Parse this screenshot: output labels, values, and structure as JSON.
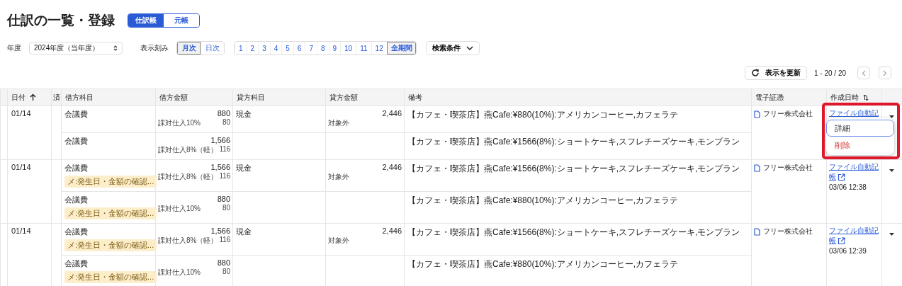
{
  "title": "仕訳の一覧・登録",
  "view_tabs": [
    {
      "label": "仕訳帳",
      "selected": true
    },
    {
      "label": "元帳",
      "selected": false
    }
  ],
  "fiscal_year": {
    "label": "年度",
    "value": "2024年度（当年度）"
  },
  "granularity": {
    "label": "表示刻み",
    "options": [
      {
        "label": "月次",
        "selected": true
      },
      {
        "label": "日次",
        "selected": false
      }
    ]
  },
  "months": [
    {
      "label": "1",
      "selected": false
    },
    {
      "label": "2",
      "selected": false
    },
    {
      "label": "3",
      "selected": false
    },
    {
      "label": "4",
      "selected": false
    },
    {
      "label": "5",
      "selected": false
    },
    {
      "label": "6",
      "selected": false
    },
    {
      "label": "7",
      "selected": false
    },
    {
      "label": "8",
      "selected": false
    },
    {
      "label": "9",
      "selected": false
    },
    {
      "label": "10",
      "selected": false
    },
    {
      "label": "11",
      "selected": false
    },
    {
      "label": "12",
      "selected": false
    },
    {
      "label": "全期間",
      "selected": true
    }
  ],
  "search_conditions": "検索条件",
  "refresh_button": "表示を更新",
  "pagination": "1 - 20 / 20",
  "columns": [
    {
      "label": "日付",
      "sort_ascending": true
    },
    {
      "label": "済"
    },
    {
      "label": "借方科目"
    },
    {
      "label": "借方金額"
    },
    {
      "label": "貸方科目"
    },
    {
      "label": "貸方金額"
    },
    {
      "label": "備考"
    },
    {
      "label": "電子証憑"
    },
    {
      "label": "作成日時",
      "sortable": true
    }
  ],
  "entries": [
    {
      "date": "01/14",
      "evidence": "フリー株式会社",
      "created_link": "ファイル自動記",
      "link_icon": false,
      "lines": [
        {
          "debit_account": "会議費",
          "debit_amount": "880",
          "tax_category": "課対仕入10%",
          "tax_amount": "80",
          "credit_account": "現金",
          "credit_amount": "2,446",
          "credit_tax": "対象外",
          "memo": "【カフェ・喫茶店】燕Cafe:¥880(10%):アメリカンコーヒー,カフェラテ"
        },
        {
          "debit_account": "会議費",
          "debit_amount": "1,566",
          "tax_category": "課対仕入8%（軽）",
          "tax_amount": "116",
          "memo": "【カフェ・喫茶店】燕Cafe:¥1566(8%):ショートケーキ,スフレチーズケーキ,モンブラン"
        }
      ]
    },
    {
      "date": "01/14",
      "evidence": "フリー株式会社",
      "created_link": "ファイル自動記帳",
      "link_icon": true,
      "created_time": "03/06 12:38",
      "lines": [
        {
          "debit_account": "会議費",
          "tag": "メ:発生日・金額の確認...",
          "debit_amount": "1,566",
          "tax_category": "課対仕入8%（軽）",
          "tax_amount": "116",
          "credit_account": "現金",
          "credit_amount": "2,446",
          "credit_tax": "対象外",
          "memo": "【カフェ・喫茶店】燕Cafe:¥1566(8%):ショートケーキ,スフレチーズケーキ,モンブラン"
        },
        {
          "debit_account": "会議費",
          "tag": "メ:発生日・金額の確認...",
          "debit_amount": "880",
          "tax_category": "課対仕入10%",
          "tax_amount": "80",
          "memo": "【カフェ・喫茶店】燕Cafe:¥880(10%):アメリカンコーヒー,カフェラテ"
        }
      ]
    },
    {
      "date": "01/14",
      "evidence": "フリー株式会社",
      "created_link": "ファイル自動記帳",
      "link_icon": true,
      "created_time": "03/06 12:39",
      "lines": [
        {
          "debit_account": "会議費",
          "tag": "メ:発生日・金額の確認...",
          "debit_amount": "1,566",
          "tax_category": "課対仕入8%（軽）",
          "tax_amount": "116",
          "credit_account": "現金",
          "credit_amount": "2,446",
          "credit_tax": "対象外",
          "memo": "【カフェ・喫茶店】燕Cafe:¥1566(8%):ショートケーキ,スフレチーズケーキ,モンブラン"
        },
        {
          "debit_account": "会議費",
          "tag": "メ:発生日・金額の確認...",
          "debit_amount": "880",
          "tax_category": "課対仕入10%",
          "tax_amount": "80",
          "memo": "【カフェ・喫茶店】燕Cafe:¥880(10%):アメリカンコーヒー,カフェラテ"
        }
      ]
    }
  ],
  "context_menu": [
    {
      "label": "詳細",
      "kind": "normal",
      "selected": true
    },
    {
      "label": "削除",
      "kind": "danger",
      "selected": false
    }
  ],
  "highlight_frame": true
}
